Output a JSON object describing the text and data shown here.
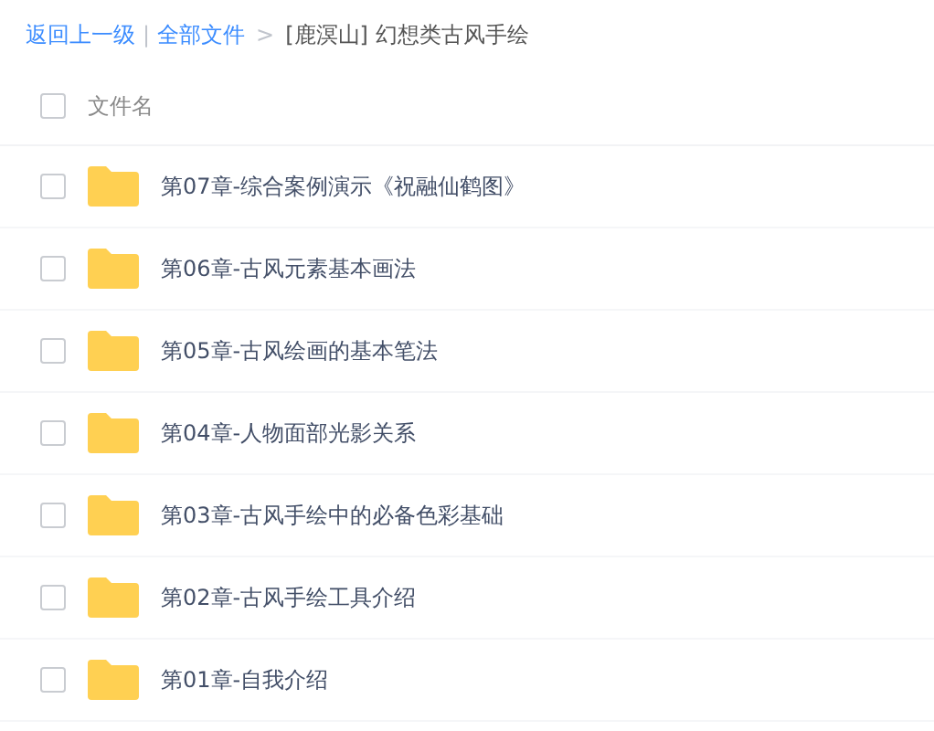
{
  "breadcrumb": {
    "back": "返回上一级",
    "separator": "|",
    "root": "全部文件",
    "arrow": ">",
    "current": "[鹿溟山] 幻想类古风手绘"
  },
  "header": {
    "checked": false,
    "label": "文件名"
  },
  "files": [
    {
      "name": "第07章-综合案例演示《祝融仙鹤图》",
      "checked": false
    },
    {
      "name": "第06章-古风元素基本画法",
      "checked": false
    },
    {
      "name": "第05章-古风绘画的基本笔法",
      "checked": false
    },
    {
      "name": "第04章-人物面部光影关系",
      "checked": false
    },
    {
      "name": "第03章-古风手绘中的必备色彩基础",
      "checked": false
    },
    {
      "name": "第02章-古风手绘工具介绍",
      "checked": false
    },
    {
      "name": "第01章-自我介绍",
      "checked": false
    }
  ]
}
